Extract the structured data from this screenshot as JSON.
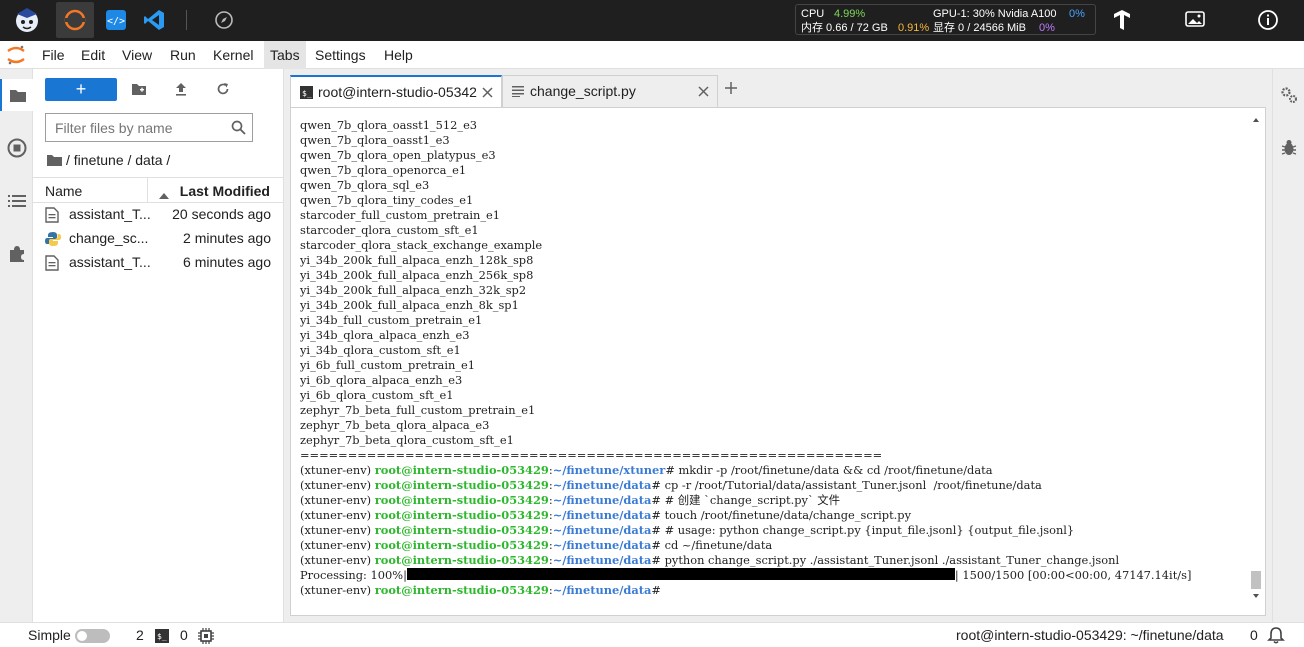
{
  "topbar": {
    "apps": [
      "intern-studio-logo",
      "jupyter-app",
      "code-app",
      "vscode-app",
      "compass-app"
    ],
    "resources": {
      "cpu_label": "CPU",
      "cpu_value": "4.99%",
      "mem_label": "内存 0.66 / 72 GB",
      "mem_value": "0.91%",
      "gpu_label": "GPU-1: 30% Nvidia A100",
      "gpu_value": "0%",
      "vram_label": "显存 0 / 24566 MiB",
      "vram_value": "0%"
    }
  },
  "menu": [
    "File",
    "Edit",
    "View",
    "Run",
    "Kernel",
    "Tabs",
    "Settings",
    "Help"
  ],
  "filebrowser": {
    "new_label": "+",
    "filter_placeholder": "Filter files by name",
    "breadcrumb": "/ finetune / data /",
    "col_name": "Name",
    "col_modified": "Last Modified",
    "files": [
      {
        "name": "assistant_T...",
        "modified": "20 seconds ago",
        "type": "file"
      },
      {
        "name": "change_sc...",
        "modified": "2 minutes ago",
        "type": "python"
      },
      {
        "name": "assistant_T...",
        "modified": "6 minutes ago",
        "type": "file"
      }
    ]
  },
  "tabs": [
    {
      "label": "root@intern-studio-05342",
      "type": "terminal"
    },
    {
      "label": "change_script.py",
      "type": "file"
    }
  ],
  "terminal": {
    "plain_lines": [
      "qwen_7b_qlora_oasst1_512_e3",
      "qwen_7b_qlora_oasst1_e3",
      "qwen_7b_qlora_open_platypus_e3",
      "qwen_7b_qlora_openorca_e1",
      "qwen_7b_qlora_sql_e3",
      "qwen_7b_qlora_tiny_codes_e1",
      "starcoder_full_custom_pretrain_e1",
      "starcoder_qlora_custom_sft_e1",
      "starcoder_qlora_stack_exchange_example",
      "yi_34b_200k_full_alpaca_enzh_128k_sp8",
      "yi_34b_200k_full_alpaca_enzh_256k_sp8",
      "yi_34b_200k_full_alpaca_enzh_32k_sp2",
      "yi_34b_200k_full_alpaca_enzh_8k_sp1",
      "yi_34b_full_custom_pretrain_e1",
      "yi_34b_qlora_alpaca_enzh_e3",
      "yi_34b_qlora_custom_sft_e1",
      "yi_6b_full_custom_pretrain_e1",
      "yi_6b_qlora_alpaca_enzh_e3",
      "yi_6b_qlora_custom_sft_e1",
      "zephyr_7b_beta_full_custom_pretrain_e1",
      "zephyr_7b_beta_qlora_alpaca_e3",
      "zephyr_7b_beta_qlora_custom_sft_e1",
      "============================================================="
    ],
    "prompts": [
      {
        "env": "(xtuner-env) ",
        "host": "root@intern-studio-053429",
        "path": "~/finetune/xtuner",
        "cmd": "# mkdir -p /root/finetune/data && cd /root/finetune/data"
      },
      {
        "env": "(xtuner-env) ",
        "host": "root@intern-studio-053429",
        "path": "~/finetune/data",
        "cmd": "# cp -r /root/Tutorial/data/assistant_Tuner.jsonl  /root/finetune/data"
      },
      {
        "env": "(xtuner-env) ",
        "host": "root@intern-studio-053429",
        "path": "~/finetune/data",
        "cmd": "# # 创建 `change_script.py` 文件"
      },
      {
        "env": "(xtuner-env) ",
        "host": "root@intern-studio-053429",
        "path": "~/finetune/data",
        "cmd": "# touch /root/finetune/data/change_script.py"
      },
      {
        "env": "(xtuner-env) ",
        "host": "root@intern-studio-053429",
        "path": "~/finetune/data",
        "cmd": "# # usage: python change_script.py {input_file.jsonl} {output_file.jsonl}"
      },
      {
        "env": "(xtuner-env) ",
        "host": "root@intern-studio-053429",
        "path": "~/finetune/data",
        "cmd": "# cd ~/finetune/data"
      },
      {
        "env": "(xtuner-env) ",
        "host": "root@intern-studio-053429",
        "path": "~/finetune/data",
        "cmd": "# python change_script.py ./assistant_Tuner.jsonl ./assistant_Tuner_change.jsonl"
      }
    ],
    "progress_prefix": "Processing: 100%|",
    "progress_suffix": "| 1500/1500 [00:00<00:00, 47147.14it/s]",
    "progress_value": 1.0,
    "final_prompt": {
      "env": "(xtuner-env) ",
      "host": "root@intern-studio-053429",
      "path": "~/finetune/data",
      "cmd": "#"
    }
  },
  "statusbar": {
    "mode_label": "Simple",
    "terminals_count": "2",
    "kernels_count": "0",
    "context": "root@intern-studio-053429: ~/finetune/data",
    "notifications": "0"
  }
}
